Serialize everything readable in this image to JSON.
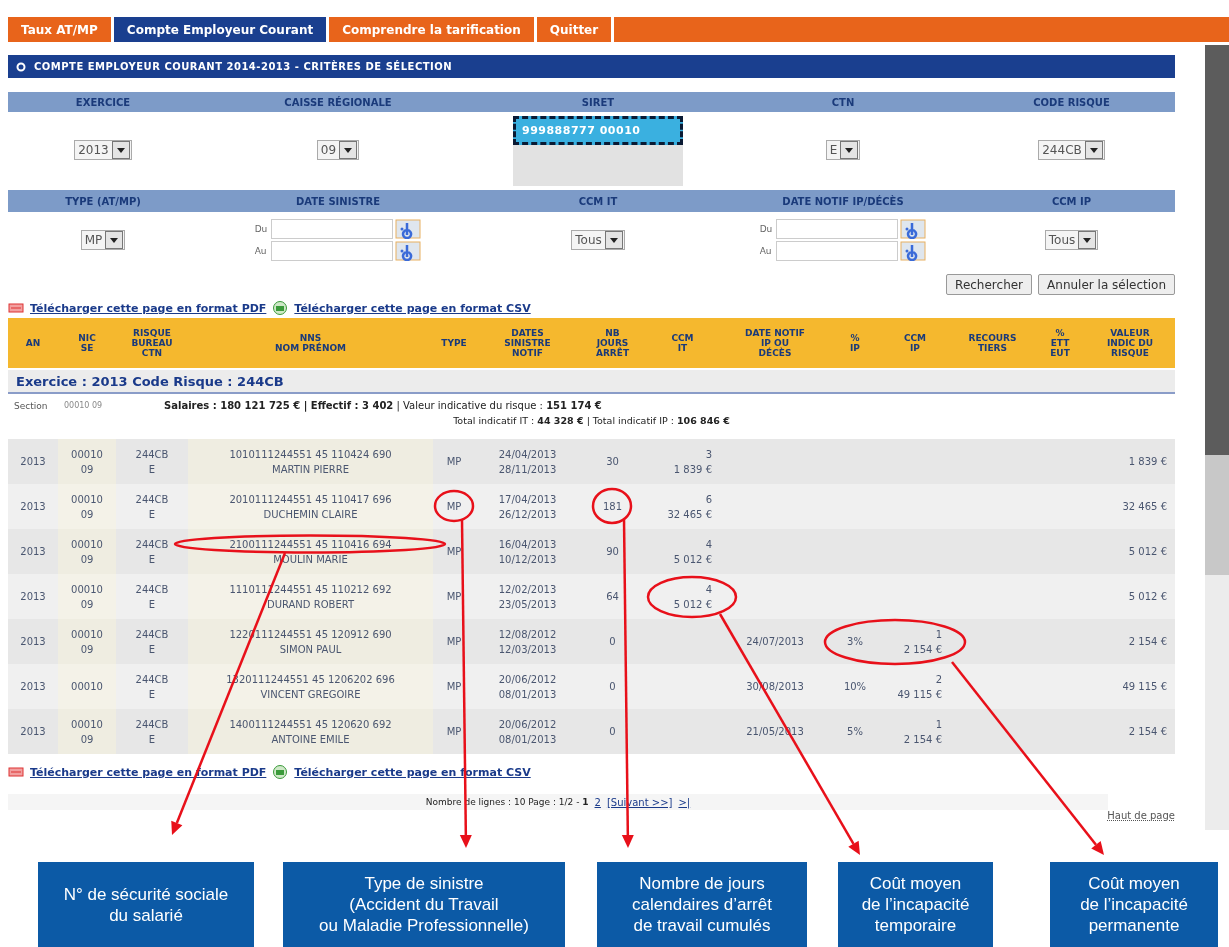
{
  "tabs": [
    {
      "label": "Taux AT/MP",
      "selected": false
    },
    {
      "label": "Compte Employeur Courant",
      "selected": true
    },
    {
      "label": "Comprendre la tarification",
      "selected": false
    },
    {
      "label": "Quitter",
      "selected": false
    }
  ],
  "section_title": "COMPTE EMPLOYEUR COURANT 2014-2013 - CRITÈRES DE SÉLECTION",
  "criteria": [
    [
      {
        "label": "EXERCICE",
        "kind": "select",
        "value": "2013"
      },
      {
        "label": "CAISSE RÉGIONALE",
        "kind": "select",
        "value": "09"
      },
      {
        "label": "SIRET",
        "kind": "list",
        "items": [
          {
            "text": "999888777 00010",
            "selected": true
          }
        ]
      },
      {
        "label": "CTN",
        "kind": "select",
        "value": "E"
      },
      {
        "label": "CODE RISQUE",
        "kind": "select",
        "value": "244CB"
      }
    ],
    [
      {
        "label": "TYPE (AT/MP)",
        "kind": "select",
        "value": "MP"
      },
      {
        "label": "DATE SINISTRE",
        "kind": "daterange",
        "from_label": "Du",
        "to_label": "Au"
      },
      {
        "label": "CCM IT",
        "kind": "select",
        "value": "Tous"
      },
      {
        "label": "DATE NOTIF IP/DÉCÈS",
        "kind": "daterange",
        "from_label": "Du",
        "to_label": "Au"
      },
      {
        "label": "CCM IP",
        "kind": "select",
        "value": "Tous"
      }
    ]
  ],
  "buttons": [
    "Rechercher",
    "Annuler la sélection"
  ],
  "downloads_top": [
    {
      "kind": "pdf",
      "label": "Télécharger cette page en format PDF"
    },
    {
      "kind": "csv",
      "label": "Télécharger cette page en format CSV"
    }
  ],
  "table": {
    "columns": [
      [
        "AN"
      ],
      [
        "NIC",
        "SE"
      ],
      [
        "RISQUE",
        "BUREAU",
        "CTN"
      ],
      [
        "NNS",
        "NOM PRÉNOM"
      ],
      [
        "TYPE"
      ],
      [
        "DATES",
        "SINISTRE",
        "NOTIF"
      ],
      [
        "NB",
        "JOURS",
        "ARRÊT"
      ],
      [
        "CCM",
        "IT"
      ],
      [
        "DATE NOTIF",
        "IP OU",
        "DÉCÈS"
      ],
      [
        "%",
        "IP"
      ],
      [
        "CCM",
        "IP"
      ],
      [
        "RECOURS",
        "TIERS"
      ],
      [
        "%",
        "ETT",
        "EUT"
      ],
      [
        "VALEUR",
        "INDIC DU",
        "RISQUE"
      ]
    ],
    "group": "Exercice : 2013 Code Risque : 244CB",
    "section_label": "Section",
    "section_value": "00010 09",
    "summary": "**Salaires : 180 121 725 € | Effectif : 3 402** | Valeur indicative du risque : **151 174 €**",
    "totals": "Total indicatif IT : **44 328 €** | Total indicatif IP : **106 846 €**",
    "rows": [
      {
        "an": "2013",
        "nic_se": [
          "00010",
          "09"
        ],
        "risque": [
          "244CB",
          "E"
        ],
        "nns_nom": [
          "1010111244551 45 110424 690",
          "MARTIN PIERRE"
        ],
        "type": "MP",
        "dates": [
          "24/04/2013",
          "28/11/2013"
        ],
        "nb_jours": "30",
        "ccm_it": [
          "3",
          "1 839 €"
        ],
        "valeur": "1 839 €"
      },
      {
        "an": "2013",
        "nic_se": [
          "00010",
          "09"
        ],
        "risque": [
          "244CB",
          "E"
        ],
        "nns_nom": [
          "2010111244551 45 110417 696",
          "DUCHEMIN CLAIRE"
        ],
        "type": "MP",
        "dates": [
          "17/04/2013",
          "26/12/2013"
        ],
        "nb_jours": "181",
        "ccm_it": [
          "6",
          "32 465 €"
        ],
        "valeur": "32 465 €"
      },
      {
        "an": "2013",
        "nic_se": [
          "00010",
          "09"
        ],
        "risque": [
          "244CB",
          "E"
        ],
        "nns_nom": [
          "2100111244551 45 110416 694",
          "MOULIN MARIE"
        ],
        "type": "MP",
        "dates": [
          "16/04/2013",
          "10/12/2013"
        ],
        "nb_jours": "90",
        "ccm_it": [
          "4",
          "5 012 €"
        ],
        "valeur": "5 012 €"
      },
      {
        "an": "2013",
        "nic_se": [
          "00010",
          "09"
        ],
        "risque": [
          "244CB",
          "E"
        ],
        "nns_nom": [
          "1110111244551 45 110212 692",
          "DURAND ROBERT"
        ],
        "type": "MP",
        "dates": [
          "12/02/2013",
          "23/05/2013"
        ],
        "nb_jours": "64",
        "ccm_it": [
          "4",
          "5 012 €"
        ],
        "valeur": "5 012 €"
      },
      {
        "an": "2013",
        "nic_se": [
          "00010",
          "09"
        ],
        "risque": [
          "244CB",
          "E"
        ],
        "nns_nom": [
          "1220111244551 45 120912 690",
          "SIMON PAUL"
        ],
        "type": "MP",
        "dates": [
          "12/08/2012",
          "12/03/2013"
        ],
        "nb_jours": "0",
        "date_notif": "24/07/2013",
        "pct_ip": "3%",
        "ccm_ip": [
          "1",
          "2 154 €"
        ],
        "valeur": "2 154 €"
      },
      {
        "an": "2013",
        "nic_se": [
          "00010"
        ],
        "risque": [
          "244CB",
          "E"
        ],
        "nns_nom": [
          "1320111244551 45 1206202 696",
          "VINCENT GREGOIRE"
        ],
        "type": "MP",
        "dates": [
          "20/06/2012",
          "08/01/2013"
        ],
        "nb_jours": "0",
        "date_notif": "30/08/2013",
        "pct_ip": "10%",
        "ccm_ip": [
          "2",
          "49 115 €"
        ],
        "valeur": "49 115 €"
      },
      {
        "an": "2013",
        "nic_se": [
          "00010",
          "09"
        ],
        "risque": [
          "244CB",
          "E"
        ],
        "nns_nom": [
          "1400111244551 45 120620 692",
          "ANTOINE EMILE"
        ],
        "type": "MP",
        "dates": [
          "20/06/2012",
          "08/01/2013"
        ],
        "nb_jours": "0",
        "date_notif": "21/05/2013",
        "pct_ip": "5%",
        "ccm_ip": [
          "1",
          "2 154 €"
        ],
        "valeur": "2 154 €"
      }
    ]
  },
  "downloads_bottom": [
    {
      "kind": "pdf",
      "label": "Télécharger cette page en format PDF"
    },
    {
      "kind": "csv",
      "label": "Télécharger cette page en format CSV"
    }
  ],
  "pagination": {
    "text": "Nombre de lignes : 10 Page : 1/2 - **1**",
    "pages": [
      "2"
    ],
    "next": "[Suivant >>]",
    "last": ">|"
  },
  "back_to_top": "Haut de page",
  "callouts": [
    [
      "N° de sécurité sociale",
      "du salarié"
    ],
    [
      "Type de sinistre",
      "(Accident du Travail",
      "ou Maladie Professionnelle)"
    ],
    [
      "Nombre de jours",
      "calendaires d’arrêt",
      "de travail cumulés"
    ],
    [
      "Coût moyen",
      "de l’incapacité",
      "temporaire"
    ],
    [
      "Coût moyen",
      "de l’incapacité",
      "permanente"
    ]
  ]
}
